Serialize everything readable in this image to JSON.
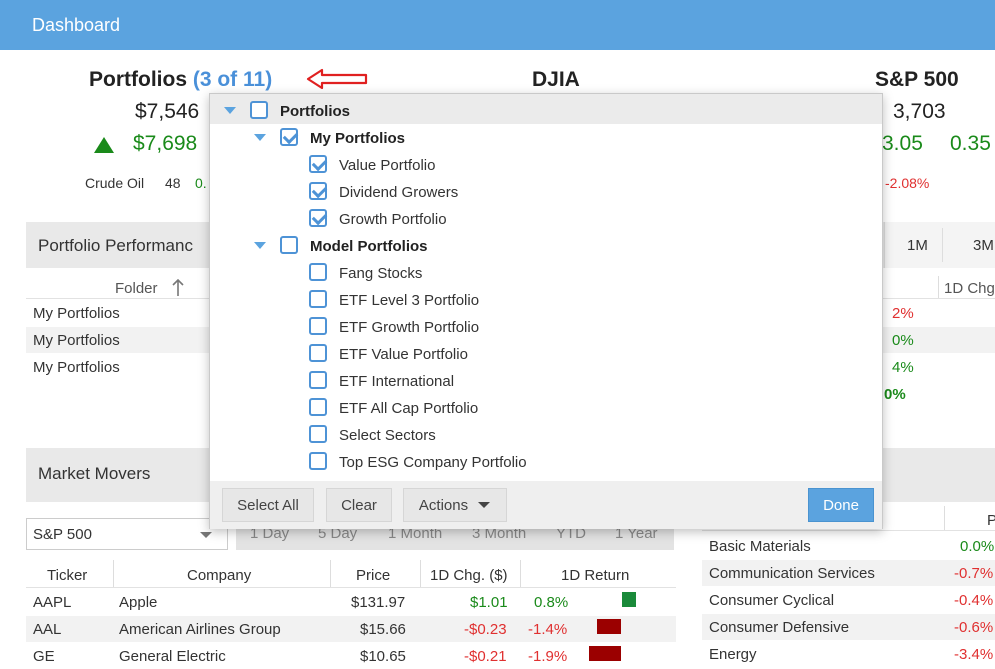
{
  "header": {
    "title": "Dashboard"
  },
  "summary": {
    "portfolios": {
      "title": "Portfolios",
      "count_label": "(3 of 11)",
      "value": "$7,546",
      "change": "$7,698"
    },
    "djia": {
      "title": "DJIA"
    },
    "sp500": {
      "title": "S&P 500",
      "value": "3,703",
      "change": "3.05",
      "pct": "0.35"
    },
    "ticker_strip": {
      "crude_label": "Crude Oil",
      "crude_value": "48",
      "crude_chg": "0.",
      "right_chg": "-2.08%"
    }
  },
  "portfolio_performance": {
    "title": "Portfolio Performanc",
    "tabs": [
      "1M",
      "3M"
    ],
    "columns": {
      "folder": "Folder",
      "chg": "1D Chg"
    },
    "rows": [
      {
        "folder": "My Portfolios",
        "chg": "2%"
      },
      {
        "folder": "My Portfolios",
        "chg": "0%"
      },
      {
        "folder": "My Portfolios",
        "chg": "4%"
      }
    ],
    "total_chg": "0%"
  },
  "market_movers": {
    "title": "Market Movers",
    "index_select": "S&P 500",
    "tabs": [
      "1 Day",
      "5 Day",
      "1 Month",
      "3 Month",
      "YTD",
      "1 Year"
    ],
    "columns": [
      "Ticker",
      "Company",
      "Price",
      "1D Chg. ($)",
      "1D Return"
    ],
    "rows": [
      {
        "ticker": "AAPL",
        "company": "Apple",
        "price": "$131.97",
        "chg": "$1.01",
        "ret": "0.8%",
        "ret_value": 0.8
      },
      {
        "ticker": "AAL",
        "company": "American Airlines Group",
        "price": "$15.66",
        "chg": "-$0.23",
        "ret": "-1.4%",
        "ret_value": -1.4
      },
      {
        "ticker": "GE",
        "company": "General Electric",
        "price": "$10.65",
        "chg": "-$0.21",
        "ret": "-1.9%",
        "ret_value": -1.9
      }
    ],
    "colors": {
      "positive": "#1a8a3a",
      "negative": "#9b0000"
    }
  },
  "sectors": {
    "col_header": "P",
    "rows": [
      {
        "name": "Basic Materials",
        "val": "0.0%"
      },
      {
        "name": "Communication Services",
        "val": "-0.7%"
      },
      {
        "name": "Consumer Cyclical",
        "val": "-0.4%"
      },
      {
        "name": "Consumer Defensive",
        "val": "-0.6%"
      },
      {
        "name": "Energy",
        "val": "-3.4%"
      }
    ]
  },
  "dropdown": {
    "root": {
      "label": "Portfolios",
      "checked": false
    },
    "groups": [
      {
        "label": "My Portfolios",
        "checked": true,
        "items": [
          {
            "label": "Value Portfolio",
            "checked": true
          },
          {
            "label": "Dividend Growers",
            "checked": true
          },
          {
            "label": "Growth Portfolio",
            "checked": true
          }
        ]
      },
      {
        "label": "Model Portfolios",
        "checked": false,
        "items": [
          {
            "label": "Fang Stocks",
            "checked": false
          },
          {
            "label": "ETF Level 3 Portfolio",
            "checked": false
          },
          {
            "label": "ETF Growth Portfolio",
            "checked": false
          },
          {
            "label": "ETF Value Portfolio",
            "checked": false
          },
          {
            "label": "ETF International",
            "checked": false
          },
          {
            "label": "ETF All Cap Portfolio",
            "checked": false
          },
          {
            "label": "Select Sectors",
            "checked": false
          },
          {
            "label": "Top ESG Company Portfolio",
            "checked": false
          }
        ]
      }
    ],
    "footer": {
      "select_all": "Select All",
      "clear": "Clear",
      "actions": "Actions",
      "done": "Done"
    }
  },
  "annotation": {
    "arrow_color": "#e02020"
  },
  "icons": {
    "up_arrow": "triangle-up-icon",
    "sort_arrow": "arrow-up-icon",
    "caret": "chevron-down-icon",
    "annotation_arrow": "arrow-left-icon"
  }
}
